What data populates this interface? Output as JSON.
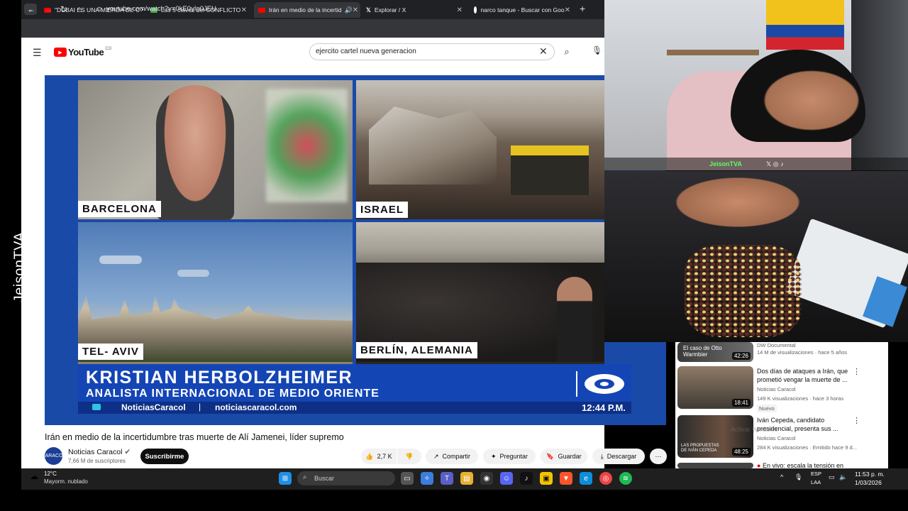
{
  "watermark": "JeisonTVA",
  "browser": {
    "tabs": [
      {
        "label": "\"DUBAI ES UNA MIERDA DE C",
        "color": "#ff0000"
      },
      {
        "label": "Las 5 claves del CONFLICTO",
        "color": "#2f7d32"
      },
      {
        "label": "Irán en medio de la incertid",
        "color": "#ff0000"
      },
      {
        "label": "Explorar / X",
        "color": "#ffffff"
      },
      {
        "label": "narco tanque - Buscar con Goo",
        "color": "#ffffff"
      }
    ],
    "new_tab": "+",
    "url": "youtube.com/watch?v=0kE0yIp0JEU"
  },
  "youtube": {
    "logo_text": "YouTube",
    "logo_country": "CO",
    "search_value": "ejercito cartel nueva generacion",
    "video": {
      "labels": {
        "barcelona": "BARCELONA",
        "israel": "ISRAEL",
        "telaviv": "TEL- AVIV",
        "berlin": "BERLÍN, ALEMANIA"
      },
      "lower_name": "KRISTIAN HERBOLZHEIMER",
      "lower_role": "ANALISTA INTERNACIONAL DE MEDIO ORIENTE",
      "ticker_handle": "NoticiasCaracol",
      "ticker_sep": "|",
      "ticker_url": "noticiascaracol.com",
      "clock": "12:44 P.M."
    },
    "title": "Irán en medio de la incertidumbre tras muerte de Alí Jamenei, líder supremo",
    "channel": {
      "name": "Noticias Caracol",
      "subs": "7,66 M de suscriptores",
      "avatar": "CARACOL"
    },
    "subscribe": "Suscribirme",
    "actions": {
      "likes": "2,7 K",
      "share": "Compartir",
      "ask": "Preguntar",
      "save": "Guardar",
      "download": "Descargar"
    },
    "recommendations": [
      {
        "title": "",
        "channel": "DW Documental",
        "meta": "14 M de visualizaciones · hace 5 años",
        "duration": "42:26",
        "thumb_text": "El caso de Otto Warmbier",
        "badge": ""
      },
      {
        "title": "Dos días de ataques a Irán, que prometió vengar la muerte de ...",
        "channel": "Noticias Caracol",
        "meta": "149 K visualizaciones · hace 3 horas",
        "duration": "18:41",
        "thumb_text": "",
        "badge": "Nuevo"
      },
      {
        "title": "Iván Cepeda, candidato presidencial, presenta sus ...",
        "channel": "Noticias Caracol",
        "meta": "284 K visualizaciones · Emitido hace 9 d...",
        "duration": "48:25",
        "thumb_text": "LAS PROPUESTAS DE IVÁN CEPEDA",
        "badge": ""
      },
      {
        "title": "En vivo: escala la tensión en ...",
        "channel": "",
        "meta": "",
        "duration": "",
        "thumb_text": "",
        "badge": ""
      }
    ]
  },
  "webcam": {
    "handle": "JeisonTVA"
  },
  "taskbar": {
    "weather_temp": "12°C",
    "weather_desc": "Mayorm. nublado",
    "search": "Buscar",
    "lang1": "ESP",
    "lang2": "LAA",
    "time": "11:53 p. m.",
    "date": "1/03/2026"
  },
  "activate_windows": "Activar Windows"
}
